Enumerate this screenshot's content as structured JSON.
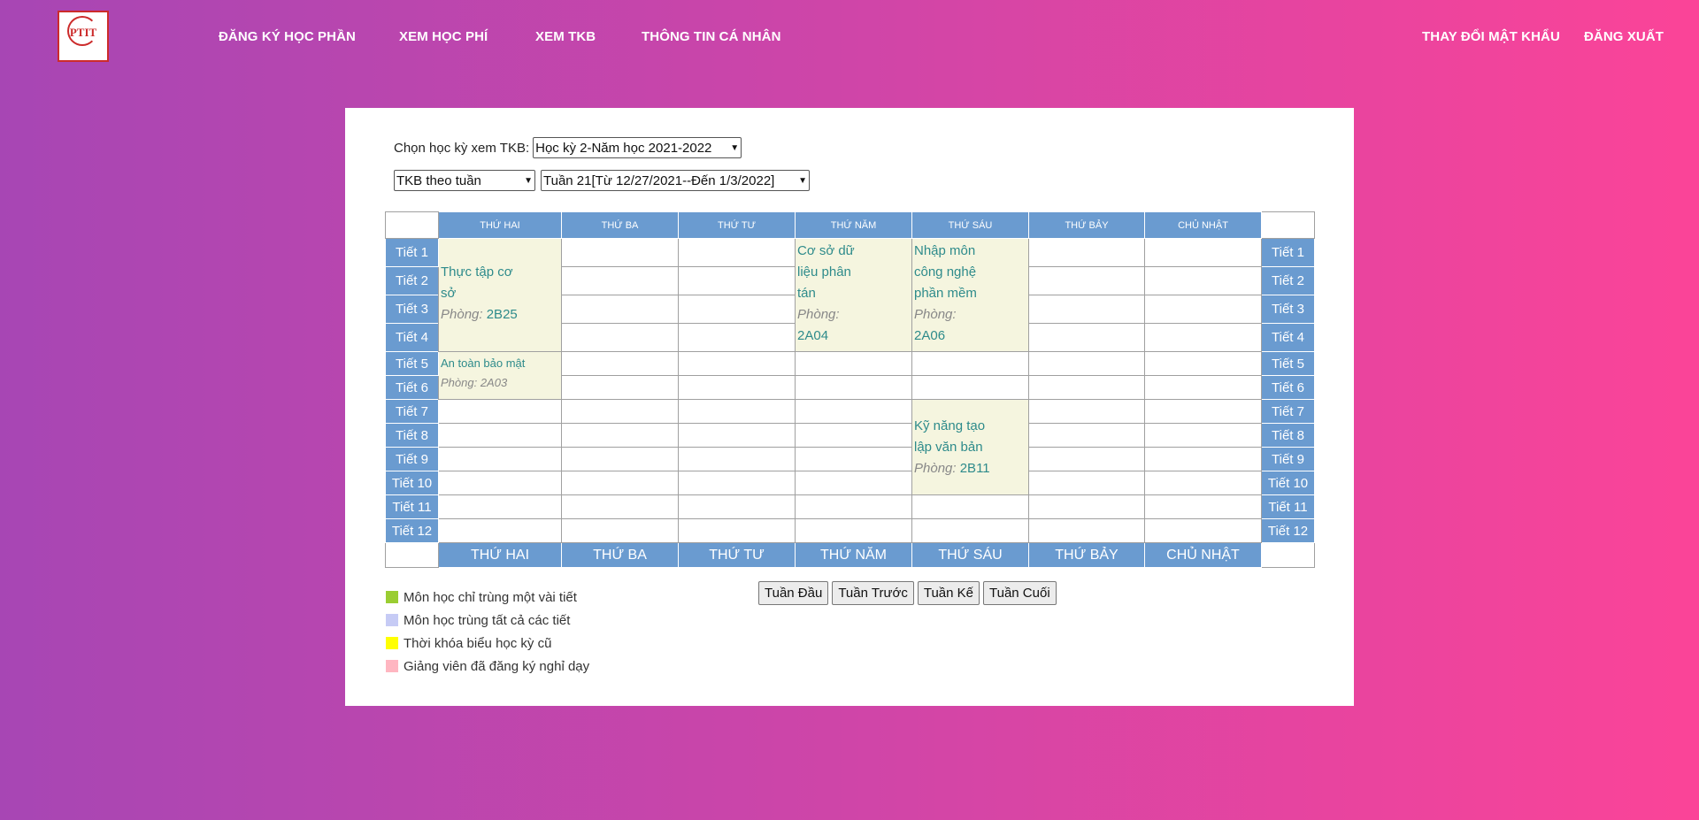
{
  "nav": {
    "logo_text": "PTIT",
    "logo_sub": "",
    "items": [
      "ĐĂNG KÝ HỌC PHẦN",
      "XEM HỌC PHÍ",
      "XEM TKB",
      "THÔNG TIN CÁ NHÂN"
    ],
    "right": [
      "THAY ĐỔI MẬT KHẨU",
      "ĐĂNG XUẤT"
    ]
  },
  "filters": {
    "semester_label": "Chọn học kỳ xem TKB:",
    "semester_value": "Học kỳ 2-Năm học 2021-2022",
    "view_mode": "TKB theo tuần",
    "week": "Tuần 21[Từ 12/27/2021--Đến 1/3/2022]"
  },
  "timetable": {
    "days_top": [
      "THỨ HAI",
      "THỨ BA",
      "THỨ TƯ",
      "THỨ NĂM",
      "THỨ SÁU",
      "THỨ BẢY",
      "CHỦ NHẬT"
    ],
    "days_bottom": [
      "THỨ HAI",
      "THỨ BA",
      "THỨ TƯ",
      "THỨ NĂM",
      "THỨ SÁU",
      "THỨ BẢY",
      "CHỦ NHẬT"
    ],
    "periods": [
      "Tiết 1",
      "Tiết 2",
      "Tiết 3",
      "Tiết 4",
      "Tiết 5",
      "Tiết 6",
      "Tiết 7",
      "Tiết 8",
      "Tiết 9",
      "Tiết 10",
      "Tiết 11",
      "Tiết 12"
    ],
    "courses": {
      "mon_1": {
        "name": "Thực tập cơ sở",
        "room_label": "Phòng:",
        "room": "2B25"
      },
      "mon_5": {
        "name": "An toàn bảo mật",
        "room_label": "Phòng:",
        "room": "2A03"
      },
      "thu_1": {
        "name": "Cơ sở dữ liệu phân tán",
        "room_label": "Phòng:",
        "room": "2A04"
      },
      "fri_1": {
        "name": "Nhập môn công nghệ phần mềm",
        "room_label": "Phòng:",
        "room": "2A06"
      },
      "fri_7": {
        "name": "Kỹ năng tạo lập văn bản",
        "room_label": "Phòng:",
        "room": "2B11"
      }
    }
  },
  "legend": [
    {
      "color": "#9acd32",
      "label": "Môn học chỉ trùng một vài tiết"
    },
    {
      "color": "#c6cbf5",
      "label": "Môn học trùng tất cả các tiết"
    },
    {
      "color": "#ffff00",
      "label": "Thời khóa biểu học kỳ cũ"
    },
    {
      "color": "#ffb6c1",
      "label": "Giảng viên đã đăng ký nghỉ dạy"
    }
  ],
  "buttons": {
    "first": "Tuần Đầu",
    "prev": "Tuần Trước",
    "next": "Tuần Kế",
    "last": "Tuần Cuối"
  }
}
